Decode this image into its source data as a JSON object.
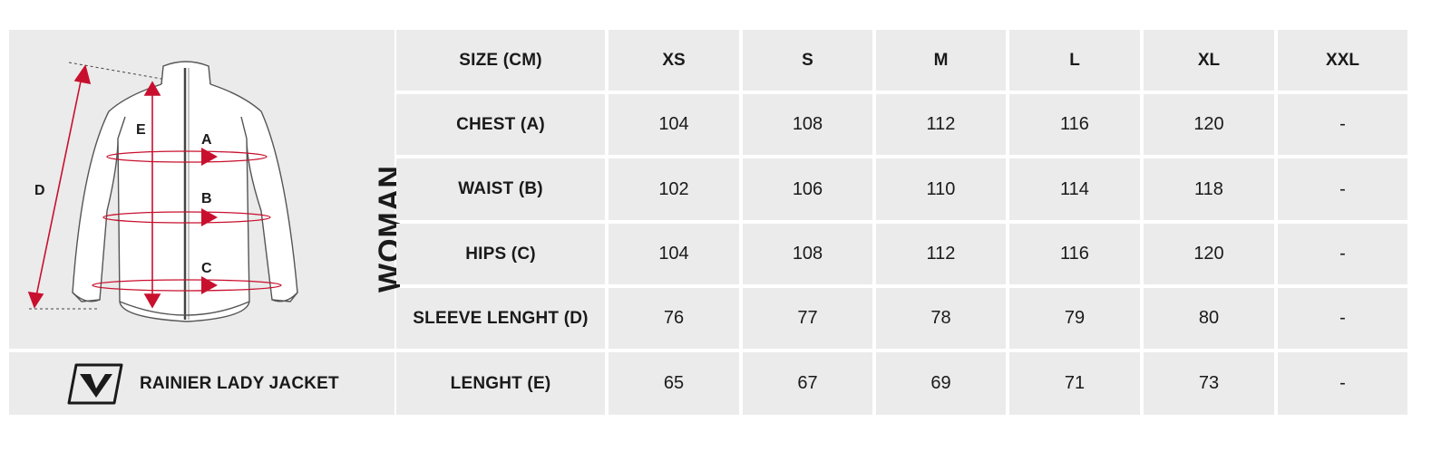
{
  "product": {
    "name": "RAINIER LADY JACKET",
    "gender": "WOMAN"
  },
  "figure": {
    "labels": [
      "A",
      "B",
      "C",
      "D",
      "E"
    ],
    "accent_color": "#c8102e"
  },
  "table": {
    "corner_label": "SIZE (CM)",
    "sizes": [
      "XS",
      "S",
      "M",
      "L",
      "XL",
      "XXL"
    ],
    "rows": [
      {
        "label": "CHEST (A)",
        "values": [
          "104",
          "108",
          "112",
          "116",
          "120",
          "-"
        ]
      },
      {
        "label": "WAIST (B)",
        "values": [
          "102",
          "106",
          "110",
          "114",
          "118",
          "-"
        ]
      },
      {
        "label": "HIPS (C)",
        "values": [
          "104",
          "108",
          "112",
          "116",
          "120",
          "-"
        ]
      },
      {
        "label": "SLEEVE LENGHT (D)",
        "values": [
          "76",
          "77",
          "78",
          "79",
          "80",
          "-"
        ]
      },
      {
        "label": "LENGHT (E)",
        "values": [
          "65",
          "67",
          "69",
          "71",
          "73",
          "-"
        ]
      }
    ]
  }
}
